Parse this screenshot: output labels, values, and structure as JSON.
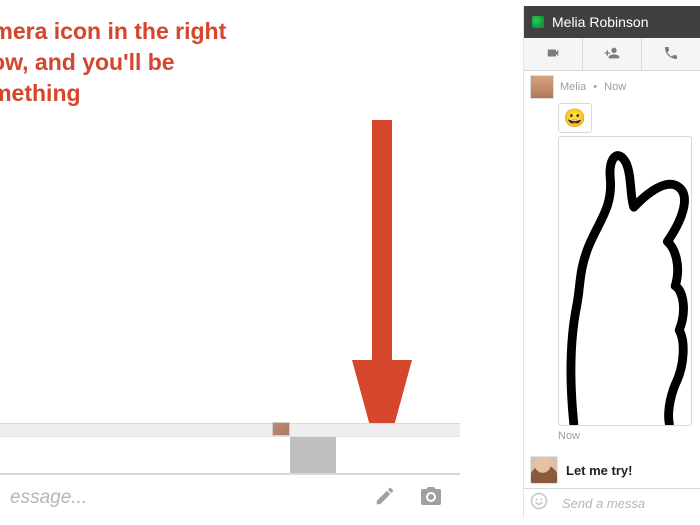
{
  "annotation": {
    "line1": "ver the camera icon in the right",
    "line2": "chat window, and you'll be",
    "line3": "sketch something"
  },
  "colors": {
    "arrow": "#d6462c"
  },
  "left_chat": {
    "placeholder": "essage...",
    "icons": {
      "pencil": "pencil-icon",
      "camera": "camera-icon"
    }
  },
  "right_chat": {
    "contact_name": "Melia Robinson",
    "toolbar": {
      "video": "video-call-icon",
      "add_person": "add-person-icon",
      "phone": "phone-call-icon"
    },
    "messages": {
      "sender_name": "Melia",
      "sender_time": "Now",
      "emoji": "😀",
      "sketch_caption": "Now",
      "reply_text": "Let me try!"
    },
    "input_placeholder": "Send a messa"
  }
}
